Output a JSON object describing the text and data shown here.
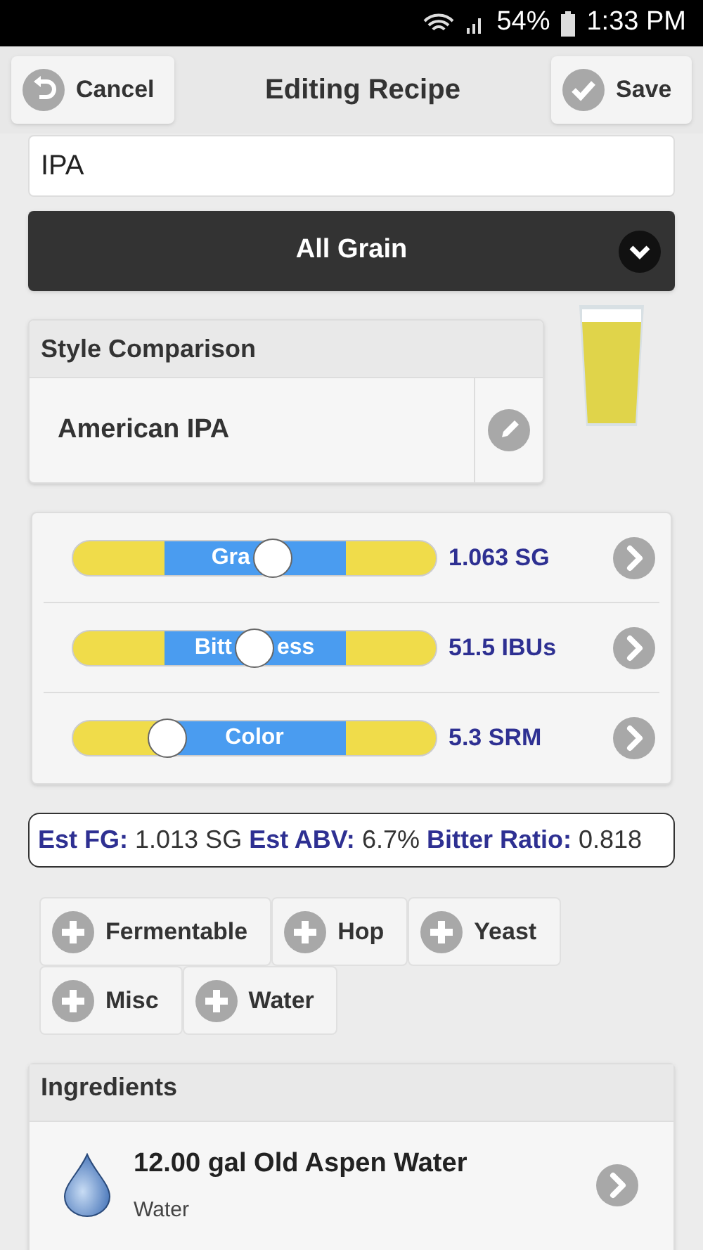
{
  "status_bar": {
    "battery": "54%",
    "time": "1:33 PM"
  },
  "header": {
    "cancel": "Cancel",
    "title": "Editing Recipe",
    "save": "Save"
  },
  "recipe_name": {
    "value": "IPA"
  },
  "type_dropdown": {
    "value": "All Grain"
  },
  "style_comparison": {
    "title": "Style Comparison",
    "style": "American IPA"
  },
  "sliders": [
    {
      "label_before": "Gra",
      "level": 0.55,
      "reading": "1.063 SG"
    },
    {
      "label_before": "Bitt",
      "label_after": "ess",
      "level": 0.5,
      "reading": "51.5 IBUs"
    },
    {
      "label": "Color",
      "level": 0.26,
      "reading": "5.3 SRM"
    }
  ],
  "estimates": [
    {
      "label": "Est FG:",
      "value": "1.013 SG"
    },
    {
      "label": "Est ABV:",
      "value": "6.7%"
    },
    {
      "label": "Bitter Ratio:",
      "value": "0.818"
    }
  ],
  "add_buttons": [
    [
      "Fermentable",
      "Hop",
      "Yeast"
    ],
    [
      "Misc",
      "Water"
    ]
  ],
  "ingredients": {
    "title": "Ingredients",
    "items": [
      {
        "name": "12.00 gal Old Aspen Water",
        "type": "Water"
      }
    ]
  }
}
